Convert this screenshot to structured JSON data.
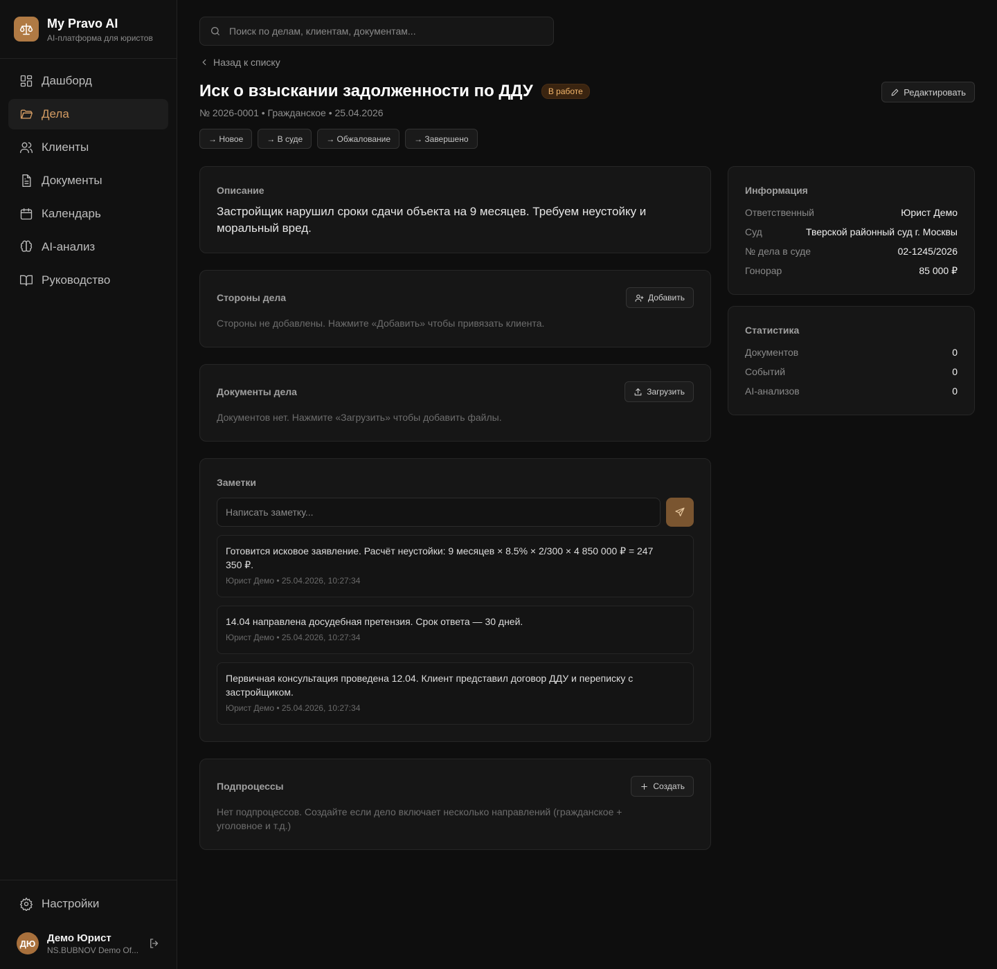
{
  "brand": {
    "title": "My Pravo AI",
    "subtitle": "AI-платформа для юристов"
  },
  "sidebar": {
    "items": [
      {
        "label": "Дашборд",
        "icon": "dashboard-icon"
      },
      {
        "label": "Дела",
        "icon": "folder-icon",
        "active": true
      },
      {
        "label": "Клиенты",
        "icon": "users-icon"
      },
      {
        "label": "Документы",
        "icon": "document-icon"
      },
      {
        "label": "Календарь",
        "icon": "calendar-icon"
      },
      {
        "label": "AI-анализ",
        "icon": "brain-icon"
      },
      {
        "label": "Руководство",
        "icon": "book-icon"
      }
    ],
    "settings_label": "Настройки",
    "user": {
      "initials": "ДЮ",
      "name": "Демо Юрист",
      "org": "NS.BUBNOV Demo Of..."
    }
  },
  "search": {
    "placeholder": "Поиск по делам, клиентам, документам..."
  },
  "back_label": "Назад к списку",
  "case": {
    "title": "Иск о взыскании задолженности по ДДУ",
    "status": "В работе",
    "meta": "№ 2026-0001 • Гражданское • 25.04.2026",
    "edit_label": "Редактировать",
    "status_actions": [
      "→ Новое",
      "→ В суде",
      "→ Обжалование",
      "→ Завершено"
    ]
  },
  "description": {
    "title": "Описание",
    "text": "Застройщик нарушил сроки сдачи объекта на 9 месяцев. Требуем неустойку и моральный вред."
  },
  "parties": {
    "title": "Стороны дела",
    "button": "Добавить",
    "empty": "Стороны не добавлены. Нажмите «Добавить» чтобы привязать клиента."
  },
  "documents": {
    "title": "Документы дела",
    "button": "Загрузить",
    "empty": "Документов нет. Нажмите «Загрузить» чтобы добавить файлы."
  },
  "notes": {
    "title": "Заметки",
    "placeholder": "Написать заметку...",
    "items": [
      {
        "text": "Готовится исковое заявление. Расчёт неустойки: 9 месяцев × 8.5% × 2/300 × 4 850 000 ₽ = 247 350 ₽.",
        "meta": "Юрист Демо • 25.04.2026, 10:27:34"
      },
      {
        "text": "14.04 направлена досудебная претензия. Срок ответа — 30 дней.",
        "meta": "Юрист Демо • 25.04.2026, 10:27:34"
      },
      {
        "text": "Первичная консультация проведена 12.04. Клиент представил договор ДДУ и переписку с застройщиком.",
        "meta": "Юрист Демо • 25.04.2026, 10:27:34"
      }
    ]
  },
  "subprocesses": {
    "title": "Подпроцессы",
    "button": "Создать",
    "empty": "Нет подпроцессов. Создайте если дело включает несколько направлений (гражданское + уголовное и т.д.)"
  },
  "info": {
    "title": "Информация",
    "rows": [
      {
        "label": "Ответственный",
        "value": "Юрист Демо"
      },
      {
        "label": "Суд",
        "value": "Тверской районный суд г. Москвы"
      },
      {
        "label": "№ дела в суде",
        "value": "02-1245/2026"
      },
      {
        "label": "Гонорар",
        "value": "85 000 ₽"
      }
    ]
  },
  "stats": {
    "title": "Статистика",
    "rows": [
      {
        "label": "Документов",
        "value": "0"
      },
      {
        "label": "Событий",
        "value": "0"
      },
      {
        "label": "AI-анализов",
        "value": "0"
      }
    ]
  },
  "colors": {
    "accent": "#d49c63",
    "brand": "#b07a44",
    "badge_bg": "#3a2410",
    "badge_text": "#f2b56a"
  }
}
